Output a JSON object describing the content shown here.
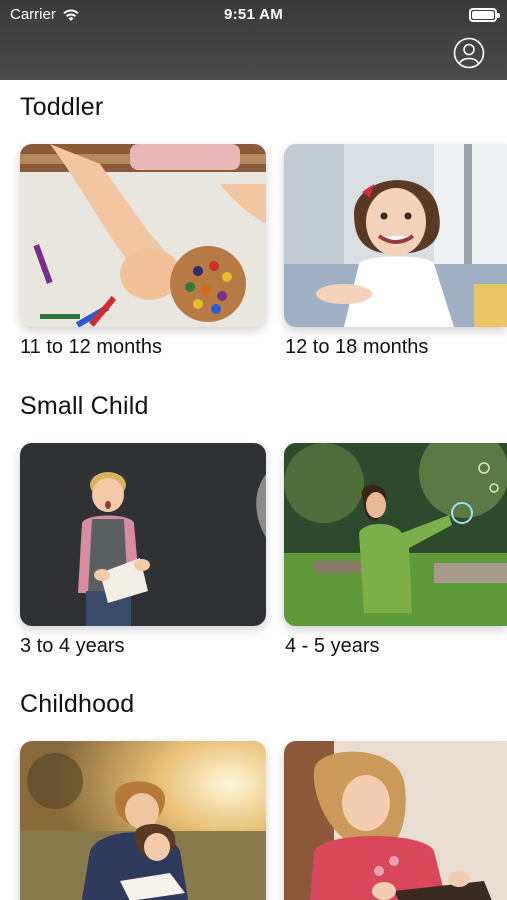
{
  "status_bar": {
    "carrier": "Carrier",
    "time": "9:51 AM"
  },
  "header": {
    "profile_icon": "person-circle-icon"
  },
  "sections": [
    {
      "title": "Toddler",
      "cards": [
        {
          "label": "11 to 12 months",
          "image": "child-playing-peg-toy-photo"
        },
        {
          "label": "12 to 18 months",
          "image": "smiling-toddler-girl-photo"
        }
      ]
    },
    {
      "title": "Small Child",
      "cards": [
        {
          "label": "3 to 4 years",
          "image": "boy-holding-book-photo",
          "favorite_icon": "heart-outline-icon"
        },
        {
          "label": "4 - 5 years",
          "image": "girl-chasing-bubbles-photo"
        }
      ]
    },
    {
      "title": "Childhood",
      "cards": [
        {
          "image": "mother-daughter-reading-photo"
        },
        {
          "image": "girl-reading-book-photo"
        }
      ]
    }
  ],
  "colors": {
    "header_bg": "#3f3f3f",
    "text": "#111111",
    "background": "#ffffff"
  }
}
